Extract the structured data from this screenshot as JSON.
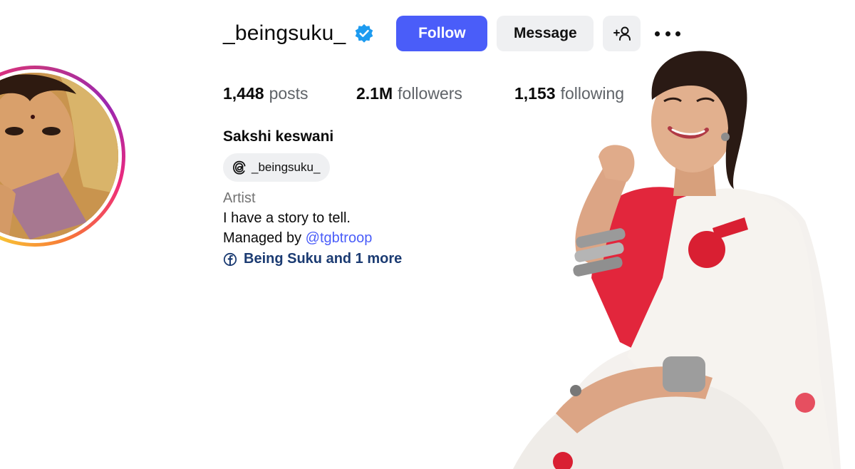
{
  "profile": {
    "username": "_beingsuku_",
    "verified_icon": "verified-badge-icon",
    "full_name": "Sakshi keswani",
    "threads_handle": "_beingsuku_",
    "category": "Artist",
    "bio_line1": "I have a story to tell.",
    "bio_line2_prefix": "Managed by ",
    "bio_line2_mention": "@tgbtroop",
    "facebook_link": "Being Suku and 1 more"
  },
  "actions": {
    "follow_label": "Follow",
    "message_label": "Message",
    "add_user_icon": "add-person-icon",
    "more_icon": "more-options-icon"
  },
  "stats": {
    "posts_count": "1,448",
    "posts_label": "posts",
    "followers_count": "2.1M",
    "followers_label": "followers",
    "following_count": "1,153",
    "following_label": "following"
  },
  "colors": {
    "follow_button": "#4a5df9",
    "secondary_button": "#eff0f2",
    "verified_badge": "#1d9bf0",
    "mention_link": "#4a5df9",
    "facebook_link": "#1b3b72",
    "muted_text": "#737373"
  }
}
